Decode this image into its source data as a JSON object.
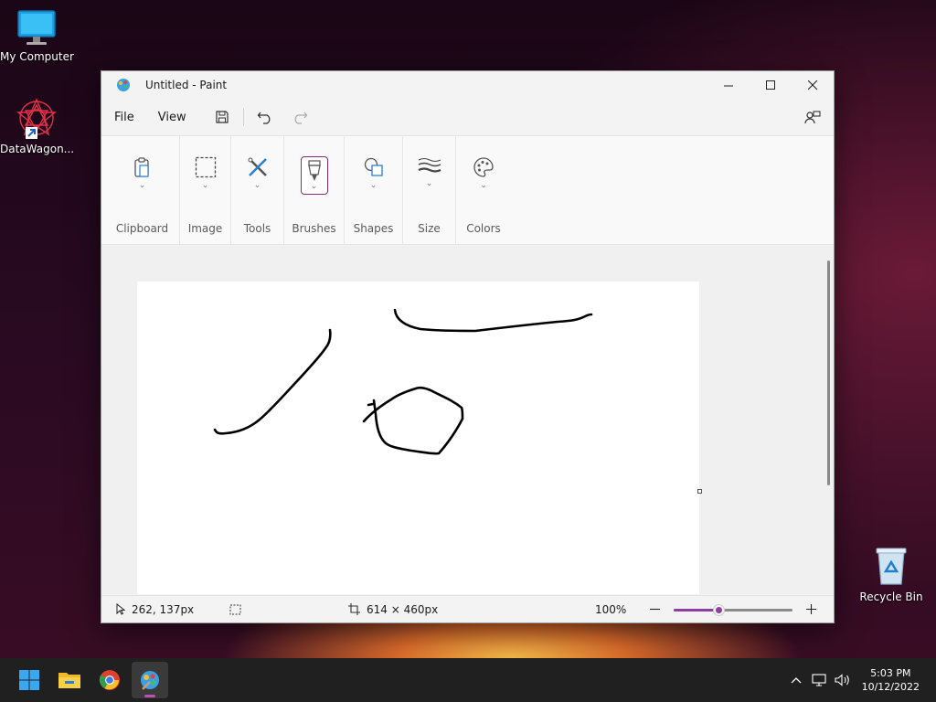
{
  "desktop": {
    "icons": [
      {
        "label": "My Computer"
      },
      {
        "label": "DataWagon..."
      },
      {
        "label": "Recycle Bin"
      }
    ]
  },
  "window": {
    "title": "Untitled - Paint",
    "menu": {
      "file": "File",
      "view": "View"
    },
    "ribbon": {
      "groups": [
        {
          "label": "Clipboard",
          "icon": "clipboard-icon"
        },
        {
          "label": "Image",
          "icon": "selection-icon"
        },
        {
          "label": "Tools",
          "icon": "tools-icon"
        },
        {
          "label": "Brushes",
          "icon": "brush-icon"
        },
        {
          "label": "Shapes",
          "icon": "shapes-icon"
        },
        {
          "label": "Size",
          "icon": "size-icon"
        },
        {
          "label": "Colors",
          "icon": "palette-icon"
        }
      ]
    },
    "status": {
      "cursor_pos": "262, 137px",
      "canvas_size": "614 × 460px",
      "zoom": "100%",
      "zoom_slider_value": 0.38
    }
  },
  "taskbar": {
    "time": "5:03 PM",
    "date": "10/12/2022"
  },
  "colors": {
    "accent": "#8a2a70",
    "zoom_slider": "#8e3ea0",
    "taskbar": "#202020"
  }
}
